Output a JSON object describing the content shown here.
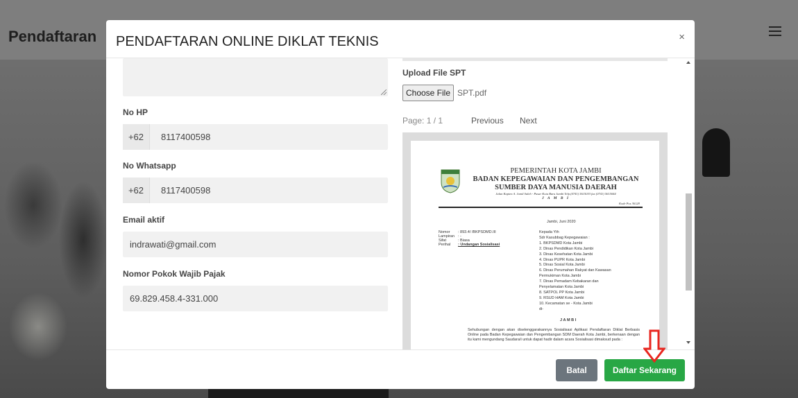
{
  "background": {
    "brand": "Pendaftaran"
  },
  "modal": {
    "title": "PENDAFTARAN ONLINE DIKLAT TEKNIS",
    "close_label": "×",
    "left": {
      "no_hp_label": "No HP",
      "no_hp_prefix": "+62",
      "no_hp_value": "8117400598",
      "no_wa_label": "No Whatsapp",
      "no_wa_prefix": "+62",
      "no_wa_value": "8117400598",
      "email_label": "Email aktif",
      "email_value": "indrawati@gmail.com",
      "npwp_label": "Nomor Pokok Wajib Pajak",
      "npwp_value": "69.829.458.4-331.000"
    },
    "right": {
      "upload_label": "Upload File SPT",
      "choose_file_label": "Choose File",
      "file_name": "SPT.pdf",
      "page_indicator": "Page: 1 / 1",
      "previous_label": "Previous",
      "next_label": "Next"
    },
    "pdf": {
      "org_line1": "PEMERINTAH KOTA JAMBI",
      "org_line2": "BADAN KEPEGAWAIAN DAN PENGEMBANGAN",
      "org_line3": "SUMBER DAYA MANUSIA DAERAH",
      "address": "Jalan Kapten A. Jamil Saleh - Pasar Kota Baru Jambi Telp.(0741) 5615033 fax (0741) 5615044",
      "city": "J A M B I",
      "postal": "Kode Pos 36128",
      "date": "Jambi,    Juni 2020",
      "meta": {
        "nomor_k": "Nomor",
        "nomor_v": ": 893.4/      /BKPSDMD.III",
        "lampiran_k": "Lampiran",
        "lampiran_v": ": -",
        "sifat_k": "Sifat",
        "sifat_v": ": Biasa",
        "perihal_k": "Perihal",
        "perihal_v": ": Undangan Sosialisasi"
      },
      "recipients": [
        "Kepada Yth",
        "Sdr Kasubbag Kepegawaian :",
        "1.   BKPSDMD Kota Jambi",
        "2.   Dinas Pendidikan Kota Jambi",
        "3.   Dinas Kesehatan Kota Jambi",
        "4.   Dinas PUPR Kota Jambi",
        "5.   Dinas Sosial Kota Jambi",
        "6.   Dinas Perumahan Rakyat dan Kawasan",
        "      Permukiman Kota Jambi",
        "7.   Dinas Pemadam Kebakaran dan",
        "      Penyelamatan Kota Jambi",
        "8.   SATPOL PP Kota Jambi",
        "9.   RSUD HAM Kota Jambi",
        "10. Kecamatan se - Kota Jambi",
        "      di-"
      ],
      "jambi_footer": "JAMBI",
      "paragraph": "Sehubungan dengan akan diselenggarakannya Sosialisasi Aplikasi Pendaftaran Diklat Berbasis Online pada Badan Kepegawaian dan Pengembangan SDM Daerah Kota Jambi, berkenaan dengan itu kami mengundang Saudara/i untuk dapat hadir dalam acara Sosialisasi dimaksud pada :"
    },
    "footer": {
      "cancel_label": "Batal",
      "submit_label": "Daftar Sekarang"
    },
    "colors": {
      "cancel_bg": "#6c757d",
      "submit_bg": "#28a745",
      "annotation_arrow": "#e8261f"
    }
  }
}
